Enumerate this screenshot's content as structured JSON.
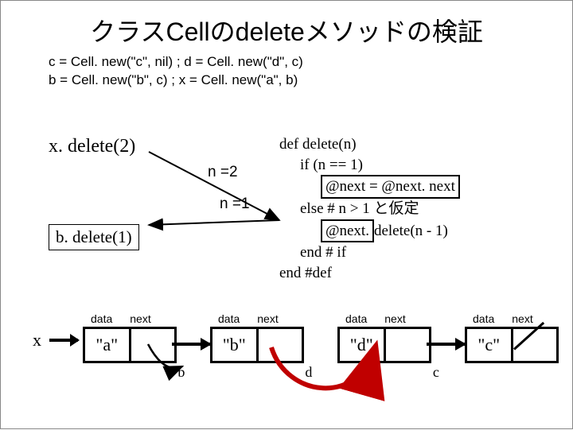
{
  "title": "クラスCellのdeleteメソッドの検証",
  "setup": {
    "line1": "c = Cell. new(\"c\", nil) ;  d = Cell. new(\"d\", c)",
    "line2": "b = Cell. new(\"b\", c) ; x = Cell. new(\"a\", b)"
  },
  "calls": {
    "x_delete": "x. delete(2)",
    "b_delete": "b. delete(1)",
    "n2": "n =2",
    "n1": "n =1"
  },
  "code": {
    "l1": "def  delete(n)",
    "l2": "if (n  == 1)",
    "l3": "@next = @next. next",
    "l4a": "else  #  n > 1 ",
    "l4b": "と仮定",
    "l5a": "@next.",
    "l5b": "delete(n - 1)",
    "l6": "end  # if",
    "l7": "end #def"
  },
  "cells": {
    "header_data": "data",
    "header_next": "next",
    "x_label": "x",
    "a": "\"a\"",
    "b": "\"b\"",
    "d": "\"d\"",
    "c": "\"c\"",
    "under_b": "b",
    "under_d": "d",
    "under_c": "c"
  }
}
